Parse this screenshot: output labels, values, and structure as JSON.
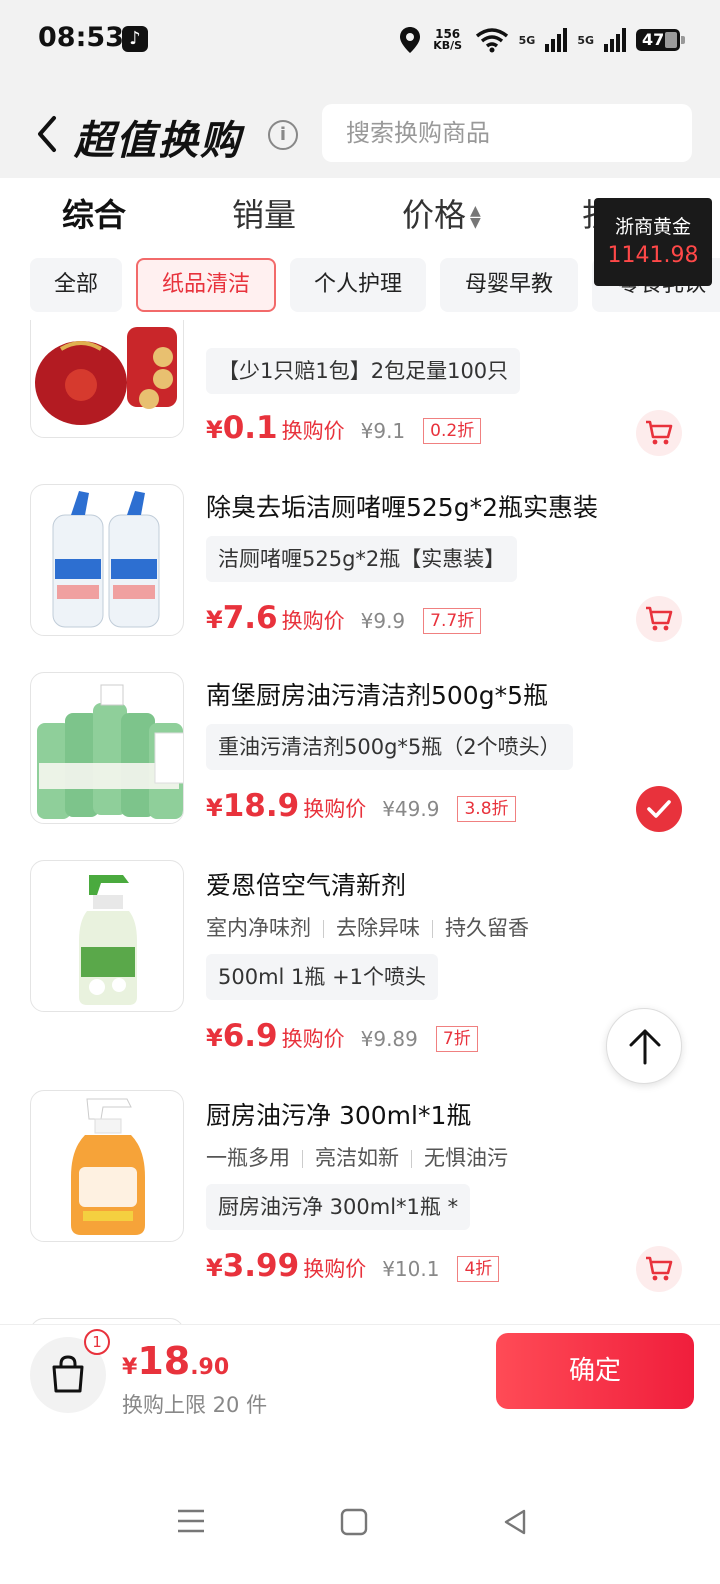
{
  "status_bar": {
    "time": "08:53",
    "speed_value": "156",
    "speed_unit": "KB/S",
    "network_1": "5G",
    "network_2": "5G",
    "battery": "47"
  },
  "header": {
    "title": "超值换购",
    "search_placeholder": "搜索换购商品"
  },
  "sort_tabs": [
    {
      "label": "综合"
    },
    {
      "label": "销量"
    },
    {
      "label": "价格"
    },
    {
      "label": "折扣"
    }
  ],
  "gold_badge": {
    "name": "浙商黄金",
    "price": "1141.98"
  },
  "categories": [
    {
      "label": "全部"
    },
    {
      "label": "纸品清洁"
    },
    {
      "label": "个人护理"
    },
    {
      "label": "母婴早教"
    },
    {
      "label": "零食乳饮"
    }
  ],
  "products": [
    {
      "spec": "【少1只赔1包】2包足量100只",
      "currency": "¥",
      "price": "0.1",
      "price_label": "换购价",
      "original_price": "¥9.1",
      "discount": "0.2折"
    },
    {
      "title": "除臭去垢洁厕啫喱525g*2瓶实惠装",
      "spec": "洁厕啫喱525g*2瓶【实惠装】",
      "currency": "¥",
      "price": "7.6",
      "price_label": "换购价",
      "original_price": "¥9.9",
      "discount": "7.7折"
    },
    {
      "title": "南堡厨房油污清洁剂500g*5瓶",
      "spec": "重油污清洁剂500g*5瓶（2个喷头）",
      "currency": "¥",
      "price": "18.9",
      "price_label": "换购价",
      "original_price": "¥49.9",
      "discount": "3.8折"
    },
    {
      "title": "爱恩倍空气清新剂",
      "tags": [
        "室内净味剂",
        "去除异味",
        "持久留香"
      ],
      "spec": "500ml 1瓶 +1个喷头",
      "currency": "¥",
      "price": "6.9",
      "price_label": "换购价",
      "original_price": "¥9.89",
      "discount": "7折"
    },
    {
      "title": "厨房油污净 300ml*1瓶",
      "tags": [
        "一瓶多用",
        "亮洁如新",
        "无惧油污"
      ],
      "spec": "厨房油污净 300ml*1瓶 *",
      "currency": "¥",
      "price": "3.99",
      "price_label": "换购价",
      "original_price": "¥10.1",
      "discount": "4折"
    }
  ],
  "footer": {
    "cart_count": "1",
    "currency": "¥",
    "total_int": "18",
    "total_dec": ".90",
    "limit_text": "换购上限 20 件",
    "confirm_label": "确定"
  },
  "colors": {
    "accent": "#e8323c",
    "badge_bg": "#1a1a1a",
    "chip_bg": "#f4f5f7"
  }
}
